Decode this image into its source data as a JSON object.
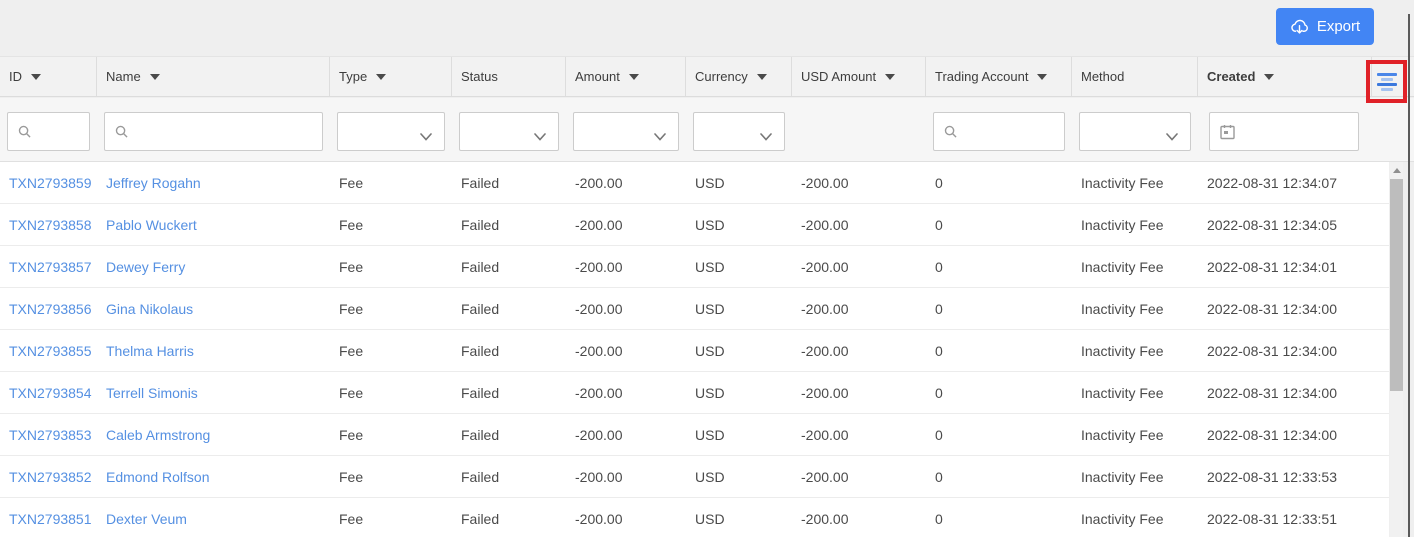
{
  "colors": {
    "export_button": "#4285f4",
    "link": "#5590e2",
    "highlight_box": "#e02128",
    "icon_blue": "#4a86e8"
  },
  "toolbar": {
    "export_label": "Export"
  },
  "table": {
    "columns": [
      {
        "key": "id",
        "label": "ID",
        "sortable": true,
        "sorted": false,
        "filter": "search"
      },
      {
        "key": "name",
        "label": "Name",
        "sortable": true,
        "sorted": false,
        "filter": "search"
      },
      {
        "key": "type",
        "label": "Type",
        "sortable": true,
        "sorted": false,
        "filter": "select"
      },
      {
        "key": "status",
        "label": "Status",
        "sortable": false,
        "sorted": false,
        "filter": "select"
      },
      {
        "key": "amount",
        "label": "Amount",
        "sortable": true,
        "sorted": false,
        "filter": "select"
      },
      {
        "key": "currency",
        "label": "Currency",
        "sortable": true,
        "sorted": false,
        "filter": "select"
      },
      {
        "key": "usd_amount",
        "label": "USD Amount",
        "sortable": true,
        "sorted": false,
        "filter": "none"
      },
      {
        "key": "trading_account",
        "label": "Trading Account",
        "sortable": true,
        "sorted": false,
        "filter": "search"
      },
      {
        "key": "method",
        "label": "Method",
        "sortable": false,
        "sorted": false,
        "filter": "select"
      },
      {
        "key": "created",
        "label": "Created",
        "sortable": true,
        "sorted": true,
        "filter": "date"
      }
    ],
    "link_columns": [
      "id",
      "name"
    ],
    "filter_values": {
      "id": "",
      "name": "",
      "type": "",
      "status": "",
      "amount": "",
      "currency": "",
      "trading_account": "",
      "method": "",
      "created": ""
    },
    "rows": [
      {
        "id": "TXN2793859",
        "name": "Jeffrey Rogahn",
        "type": "Fee",
        "status": "Failed",
        "amount": "-200.00",
        "currency": "USD",
        "usd_amount": "-200.00",
        "trading_account": "0",
        "method": "Inactivity Fee",
        "created": "2022-08-31 12:34:07"
      },
      {
        "id": "TXN2793858",
        "name": "Pablo Wuckert",
        "type": "Fee",
        "status": "Failed",
        "amount": "-200.00",
        "currency": "USD",
        "usd_amount": "-200.00",
        "trading_account": "0",
        "method": "Inactivity Fee",
        "created": "2022-08-31 12:34:05"
      },
      {
        "id": "TXN2793857",
        "name": "Dewey Ferry",
        "type": "Fee",
        "status": "Failed",
        "amount": "-200.00",
        "currency": "USD",
        "usd_amount": "-200.00",
        "trading_account": "0",
        "method": "Inactivity Fee",
        "created": "2022-08-31 12:34:01"
      },
      {
        "id": "TXN2793856",
        "name": "Gina Nikolaus",
        "type": "Fee",
        "status": "Failed",
        "amount": "-200.00",
        "currency": "USD",
        "usd_amount": "-200.00",
        "trading_account": "0",
        "method": "Inactivity Fee",
        "created": "2022-08-31 12:34:00"
      },
      {
        "id": "TXN2793855",
        "name": "Thelma Harris",
        "type": "Fee",
        "status": "Failed",
        "amount": "-200.00",
        "currency": "USD",
        "usd_amount": "-200.00",
        "trading_account": "0",
        "method": "Inactivity Fee",
        "created": "2022-08-31 12:34:00"
      },
      {
        "id": "TXN2793854",
        "name": "Terrell Simonis",
        "type": "Fee",
        "status": "Failed",
        "amount": "-200.00",
        "currency": "USD",
        "usd_amount": "-200.00",
        "trading_account": "0",
        "method": "Inactivity Fee",
        "created": "2022-08-31 12:34:00"
      },
      {
        "id": "TXN2793853",
        "name": "Caleb Armstrong",
        "type": "Fee",
        "status": "Failed",
        "amount": "-200.00",
        "currency": "USD",
        "usd_amount": "-200.00",
        "trading_account": "0",
        "method": "Inactivity Fee",
        "created": "2022-08-31 12:34:00"
      },
      {
        "id": "TXN2793852",
        "name": "Edmond Rolfson",
        "type": "Fee",
        "status": "Failed",
        "amount": "-200.00",
        "currency": "USD",
        "usd_amount": "-200.00",
        "trading_account": "0",
        "method": "Inactivity Fee",
        "created": "2022-08-31 12:33:53"
      },
      {
        "id": "TXN2793851",
        "name": "Dexter Veum",
        "type": "Fee",
        "status": "Failed",
        "amount": "-200.00",
        "currency": "USD",
        "usd_amount": "-200.00",
        "trading_account": "0",
        "method": "Inactivity Fee",
        "created": "2022-08-31 12:33:51"
      }
    ]
  }
}
